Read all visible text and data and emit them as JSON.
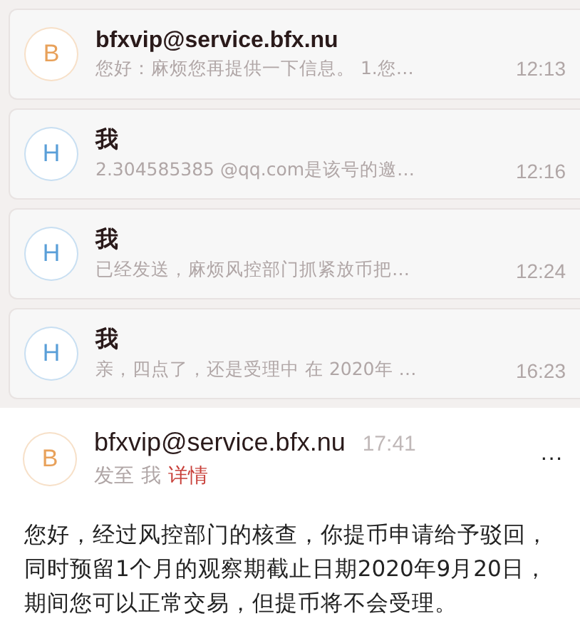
{
  "threads": [
    {
      "avatar": {
        "letter": "B",
        "color": "#e8a15a"
      },
      "sender": "bfxvip@service.bfx.nu",
      "preview": "您好：麻烦您再提供一下信息。 1.您…",
      "time": "12:13"
    },
    {
      "avatar": {
        "letter": "H",
        "color": "#5a9fd8"
      },
      "sender": "我",
      "preview": "2.304585385 @qq.com是该号的邀…",
      "time": "12:16"
    },
    {
      "avatar": {
        "letter": "H",
        "color": "#5a9fd8"
      },
      "sender": "我",
      "preview": "已经发送，麻烦风控部门抓紧放币把…",
      "time": "12:24"
    },
    {
      "avatar": {
        "letter": "H",
        "color": "#5a9fd8"
      },
      "sender": "我",
      "preview": "亲，四点了，还是受理中 在 2020年 …",
      "time": "16:23"
    }
  ],
  "message": {
    "avatar": {
      "letter": "B",
      "color": "#e8a15a"
    },
    "sender": "bfxvip@service.bfx.nu",
    "time": "17:41",
    "sent_to_label": "发至",
    "recipient": "我",
    "details_link": "详情",
    "more": "···",
    "body": "您好，经过风控部门的核查，你提币申请给予驳回，同时预留1个月的观察期截止日期2020年9月20日，期间您可以正常交易，但提币将不会受理。"
  }
}
